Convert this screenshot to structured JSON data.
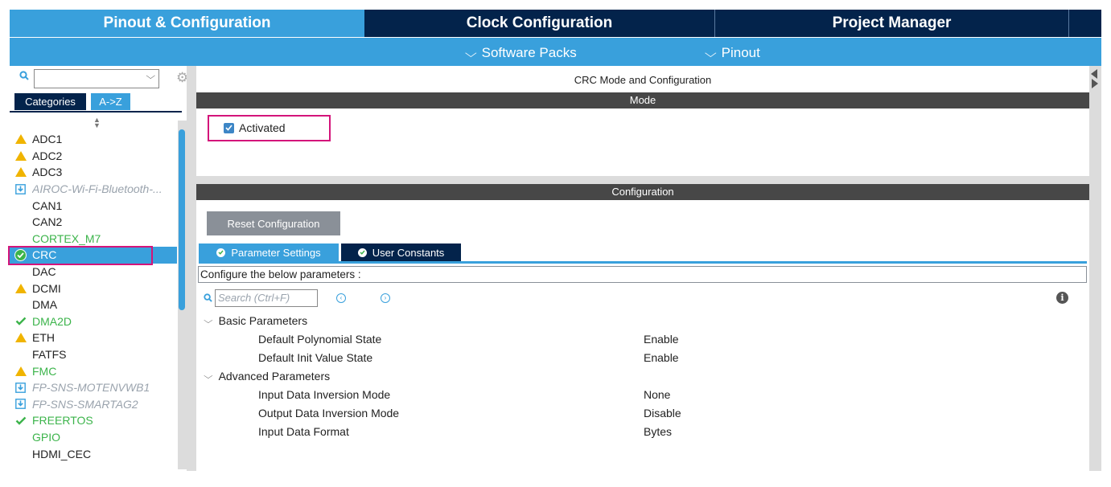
{
  "tabs": [
    {
      "label": "Pinout & Configuration"
    },
    {
      "label": "Clock Configuration"
    },
    {
      "label": "Project Manager"
    }
  ],
  "subbar": {
    "software_packs": "Software Packs",
    "pinout": "Pinout"
  },
  "left": {
    "search": {
      "value": ""
    },
    "tabs": {
      "categories": "Categories",
      "az": "A->Z"
    },
    "items": [
      {
        "label": "ADC1",
        "state": "warn"
      },
      {
        "label": "ADC2",
        "state": "warn"
      },
      {
        "label": "ADC3",
        "state": "warn"
      },
      {
        "label": "AIROC-Wi-Fi-Bluetooth-...",
        "state": "pack"
      },
      {
        "label": "CAN1",
        "state": "none"
      },
      {
        "label": "CAN2",
        "state": "none"
      },
      {
        "label": "CORTEX_M7",
        "state": "green"
      },
      {
        "label": "CRC",
        "state": "selected"
      },
      {
        "label": "DAC",
        "state": "none"
      },
      {
        "label": "DCMI",
        "state": "warn"
      },
      {
        "label": "DMA",
        "state": "none"
      },
      {
        "label": "DMA2D",
        "state": "ok"
      },
      {
        "label": "ETH",
        "state": "warn"
      },
      {
        "label": "FATFS",
        "state": "none"
      },
      {
        "label": "FMC",
        "state": "warn-green"
      },
      {
        "label": "FP-SNS-MOTENVWB1",
        "state": "pack"
      },
      {
        "label": "FP-SNS-SMARTAG2",
        "state": "pack"
      },
      {
        "label": "FREERTOS",
        "state": "ok"
      },
      {
        "label": "GPIO",
        "state": "green"
      },
      {
        "label": "HDMI_CEC",
        "state": "none"
      }
    ]
  },
  "right": {
    "title": "CRC Mode and Configuration",
    "mode_bar": "Mode",
    "activated_label": "Activated",
    "config_bar": "Configuration",
    "reset_button": "Reset Configuration",
    "param_tab": "Parameter Settings",
    "user_tab": "User Constants",
    "configure_text": "Configure the below parameters :",
    "search_placeholder": "Search (Ctrl+F)",
    "groups": [
      {
        "label": "Basic Parameters",
        "params": [
          {
            "name": "Default Polynomial State",
            "value": "Enable"
          },
          {
            "name": "Default Init Value State",
            "value": "Enable"
          }
        ]
      },
      {
        "label": "Advanced Parameters",
        "params": [
          {
            "name": "Input Data Inversion Mode",
            "value": "None"
          },
          {
            "name": "Output Data Inversion Mode",
            "value": "Disable"
          },
          {
            "name": "Input Data Format",
            "value": "Bytes"
          }
        ]
      }
    ]
  },
  "colors": {
    "accent": "#39a0dc",
    "dark": "#03234b",
    "highlight": "#d4147a",
    "ok": "#3cb44b",
    "warn": "#f0b400"
  }
}
